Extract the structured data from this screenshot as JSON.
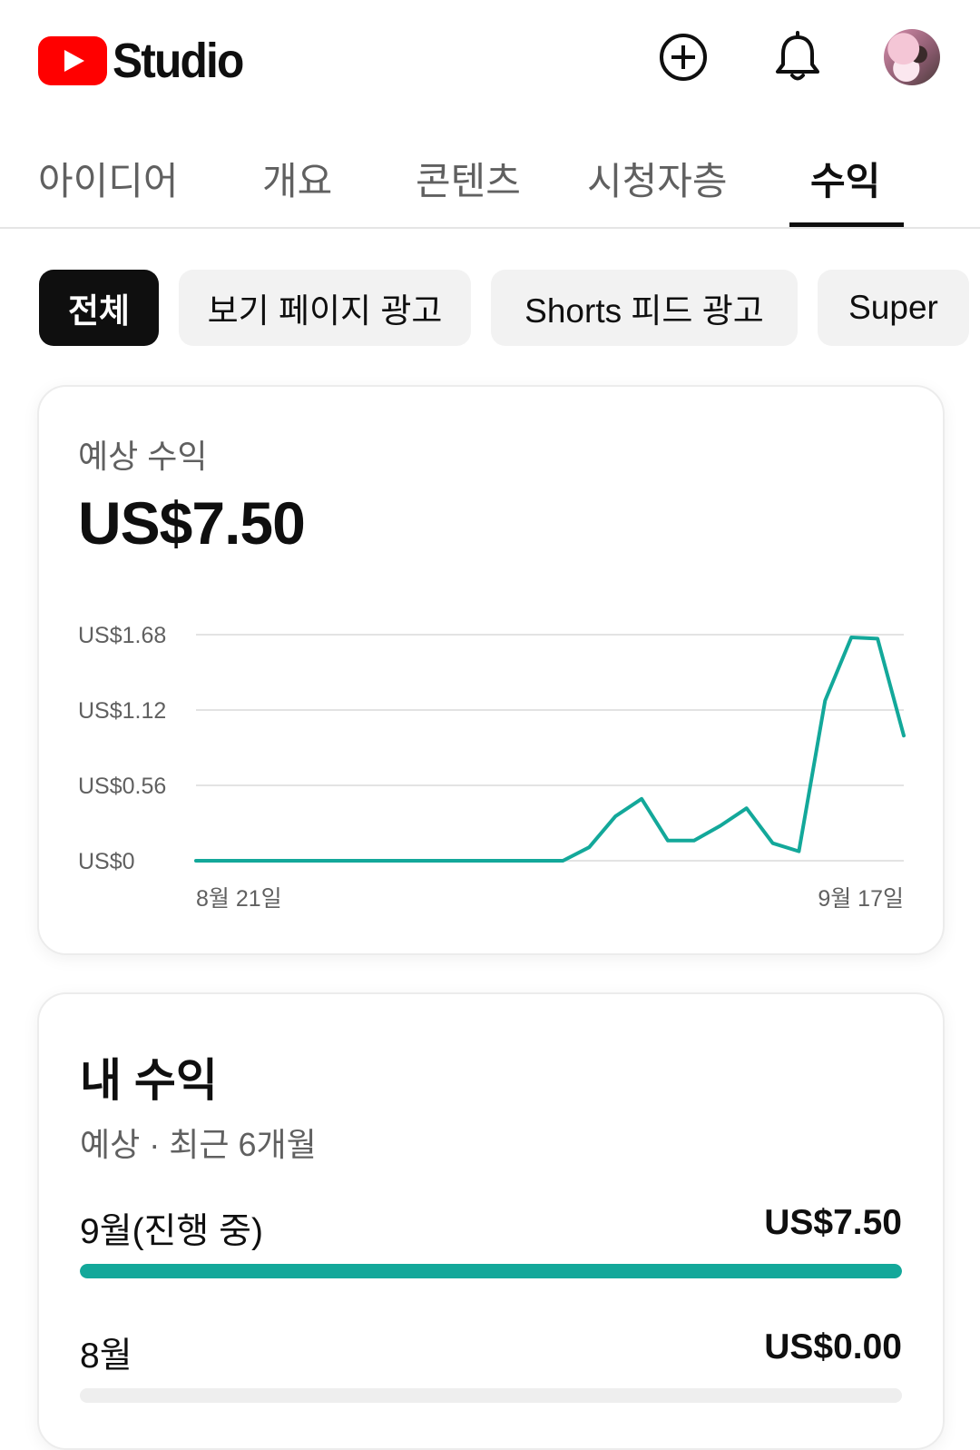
{
  "header": {
    "logo_text": "Studio",
    "icons": [
      "youtube-logo-icon",
      "create-icon",
      "notifications-bell-icon",
      "avatar"
    ]
  },
  "tabs": [
    {
      "label": "아이디어",
      "active": false
    },
    {
      "label": "개요",
      "active": false
    },
    {
      "label": "콘텐츠",
      "active": false
    },
    {
      "label": "시청자층",
      "active": false
    },
    {
      "label": "수익",
      "active": true
    }
  ],
  "chips": [
    {
      "label": "전체",
      "active": true
    },
    {
      "label": "보기 페이지 광고",
      "active": false
    },
    {
      "label": "Shorts 피드 광고",
      "active": false
    },
    {
      "label": "Super",
      "active": false
    }
  ],
  "estimated_revenue": {
    "label": "예상 수익",
    "value": "US$7.50"
  },
  "chart_data": {
    "type": "line",
    "ylim": [
      0,
      1.68
    ],
    "y_ticks": [
      "US$1.68",
      "US$1.12",
      "US$0.56",
      "US$0"
    ],
    "x_tick_labels": [
      "8월 21일",
      "9월 17일"
    ],
    "grid": true,
    "line_color": "#13a89a",
    "series": [
      {
        "values": [
          0,
          0,
          0,
          0,
          0,
          0,
          0,
          0,
          0,
          0,
          0,
          0,
          0,
          0,
          0,
          0.1,
          0.33,
          0.46,
          0.15,
          0.15,
          0.26,
          0.39,
          0.13,
          0.07,
          1.19,
          1.66,
          1.65,
          0.93
        ]
      }
    ]
  },
  "my_revenue": {
    "title": "내 수익",
    "subtitle": "예상 · 최근 6개월",
    "rows": [
      {
        "label": "9월(진행 중)",
        "value": "US$7.50",
        "fraction": 1.0
      },
      {
        "label": "8월",
        "value": "US$0.00",
        "fraction": 0.0
      }
    ]
  },
  "colors": {
    "accent": "#13a89a",
    "brand_red": "#ff0000",
    "text_primary": "#0f0f0f",
    "text_secondary": "#606060"
  }
}
